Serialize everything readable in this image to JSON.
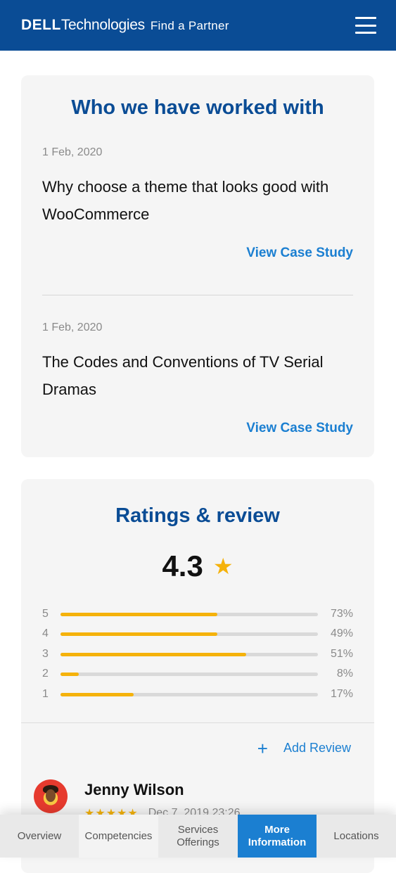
{
  "header": {
    "brand_dell": "DELL",
    "brand_tech": "Technologies",
    "brand_find": "Find a Partner",
    "menu_icon": "hamburger-menu-icon"
  },
  "worked_with": {
    "title": "Who we have worked with",
    "cases": [
      {
        "date": "1 Feb, 2020",
        "title": "Why choose a theme that looks good with WooCommerce",
        "link": "View Case Study"
      },
      {
        "date": "1 Feb, 2020",
        "title": "The Codes and Conventions of TV Serial Dramas",
        "link": "View Case Study"
      }
    ]
  },
  "ratings": {
    "title": "Ratings & review",
    "score": "4.3",
    "star_icon": "star-icon",
    "bars": [
      {
        "label": "5",
        "pct": "73%",
        "fill": 0.61
      },
      {
        "label": "4",
        "pct": "49%",
        "fill": 0.61
      },
      {
        "label": "3",
        "pct": "51%",
        "fill": 0.72
      },
      {
        "label": "2",
        "pct": "8%",
        "fill": 0.07
      },
      {
        "label": "1",
        "pct": "17%",
        "fill": 0.285
      }
    ],
    "add_review": "Add Review",
    "add_icon": "plus-icon"
  },
  "review": {
    "name": "Jenny Wilson",
    "stars": "★★★★★",
    "date": "Dec 7, 2019 23:26"
  },
  "nav": {
    "items": [
      {
        "label": "Overview"
      },
      {
        "label": "Competencies"
      },
      {
        "label": "Services Offerings"
      },
      {
        "label": "More Information"
      },
      {
        "label": "Locations"
      }
    ],
    "active": "More Information"
  },
  "colors": {
    "brand_blue": "#0a4c95",
    "link_blue": "#1b7fd1",
    "star_yellow": "#f5b20b",
    "card_bg": "#f5f5f5"
  }
}
